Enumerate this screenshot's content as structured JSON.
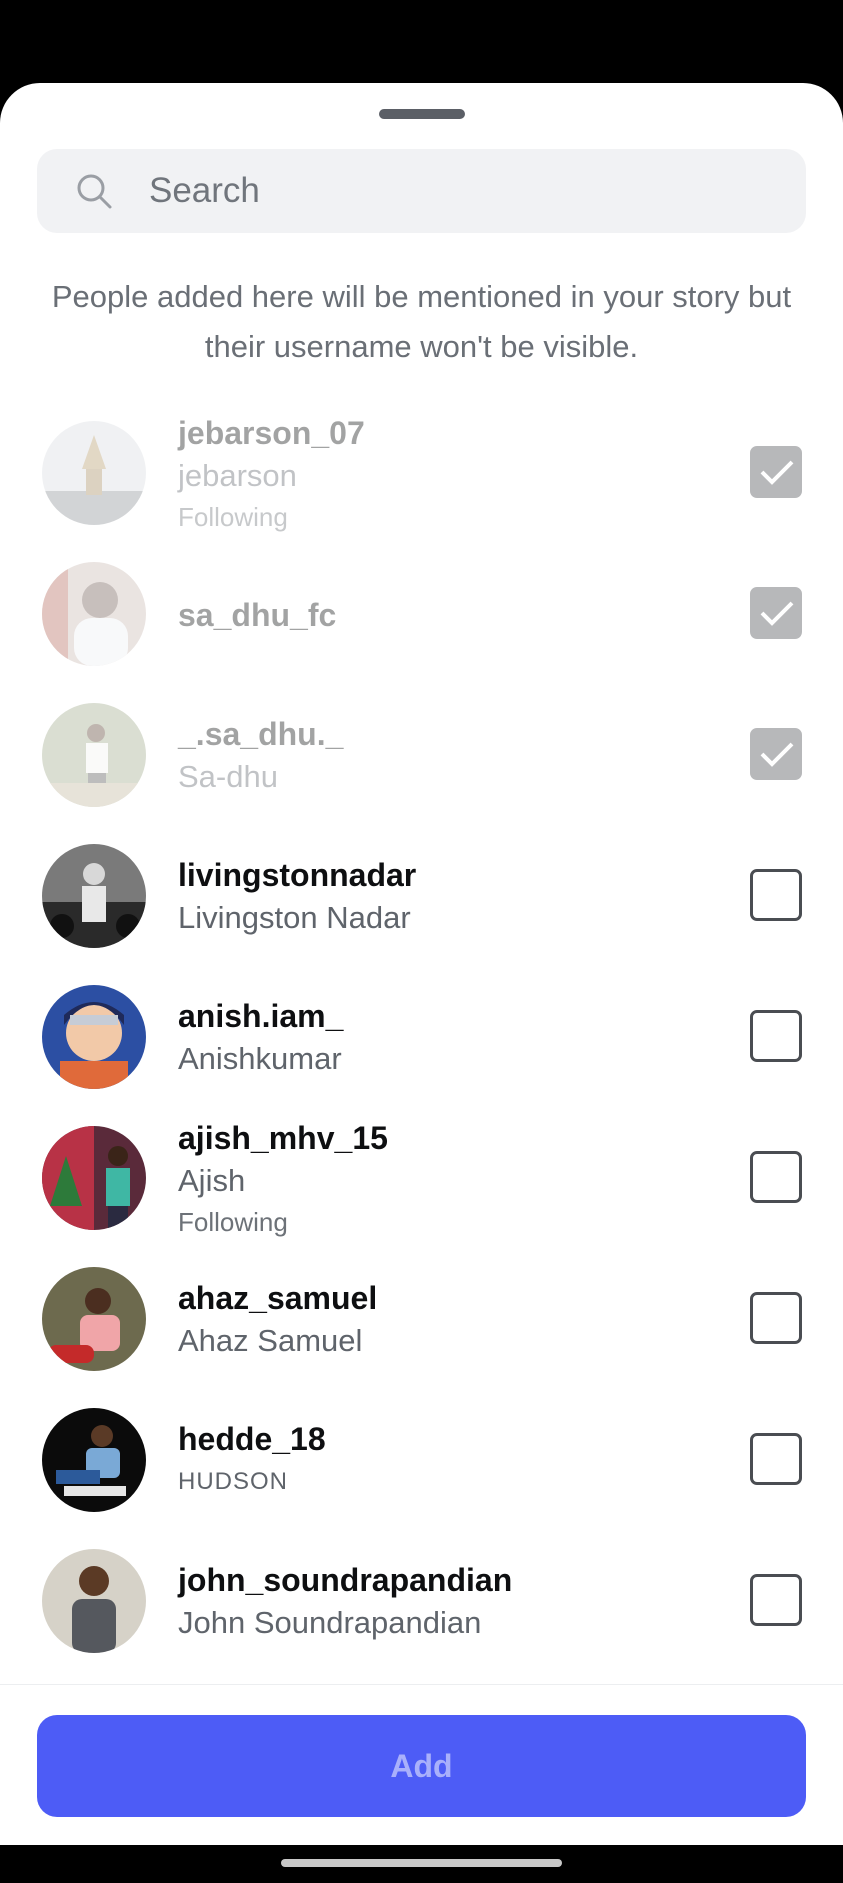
{
  "search": {
    "placeholder": "Search",
    "value": ""
  },
  "notice": "People added here will be mentioned in your story but their username won't be visible.",
  "people": [
    {
      "username": "jebarson_07",
      "full_name": "jebarson",
      "status": "Following",
      "checked": true,
      "disabled": true
    },
    {
      "username": "sa_dhu_fc",
      "full_name": "",
      "status": "",
      "checked": true,
      "disabled": true
    },
    {
      "username": "_.sa_dhu._",
      "full_name": "Sa-dhu",
      "status": "",
      "checked": true,
      "disabled": true
    },
    {
      "username": "livingstonnadar",
      "full_name": "Livingston Nadar",
      "status": "",
      "checked": false,
      "disabled": false
    },
    {
      "username": "anish.iam_",
      "full_name": "Anishkumar",
      "status": "",
      "checked": false,
      "disabled": false
    },
    {
      "username": "ajish_mhv_15",
      "full_name": "Ajish",
      "status": "Following",
      "checked": false,
      "disabled": false
    },
    {
      "username": "ahaz_samuel",
      "full_name": "Ahaz Samuel",
      "status": "",
      "checked": false,
      "disabled": false
    },
    {
      "username": "hedde_18",
      "full_name": "HUDSON",
      "status": "",
      "checked": false,
      "disabled": false
    },
    {
      "username": "john_soundrapandian",
      "full_name": "John Soundrapandian",
      "status": "",
      "checked": false,
      "disabled": false
    }
  ],
  "footer": {
    "add_label": "Add"
  },
  "colors": {
    "accent": "#4d5cf6",
    "accent_text": "#a9b0fb",
    "checked_box": "#b7b8ba"
  },
  "icons": {
    "search": "search-icon",
    "check": "checkmark-icon"
  }
}
